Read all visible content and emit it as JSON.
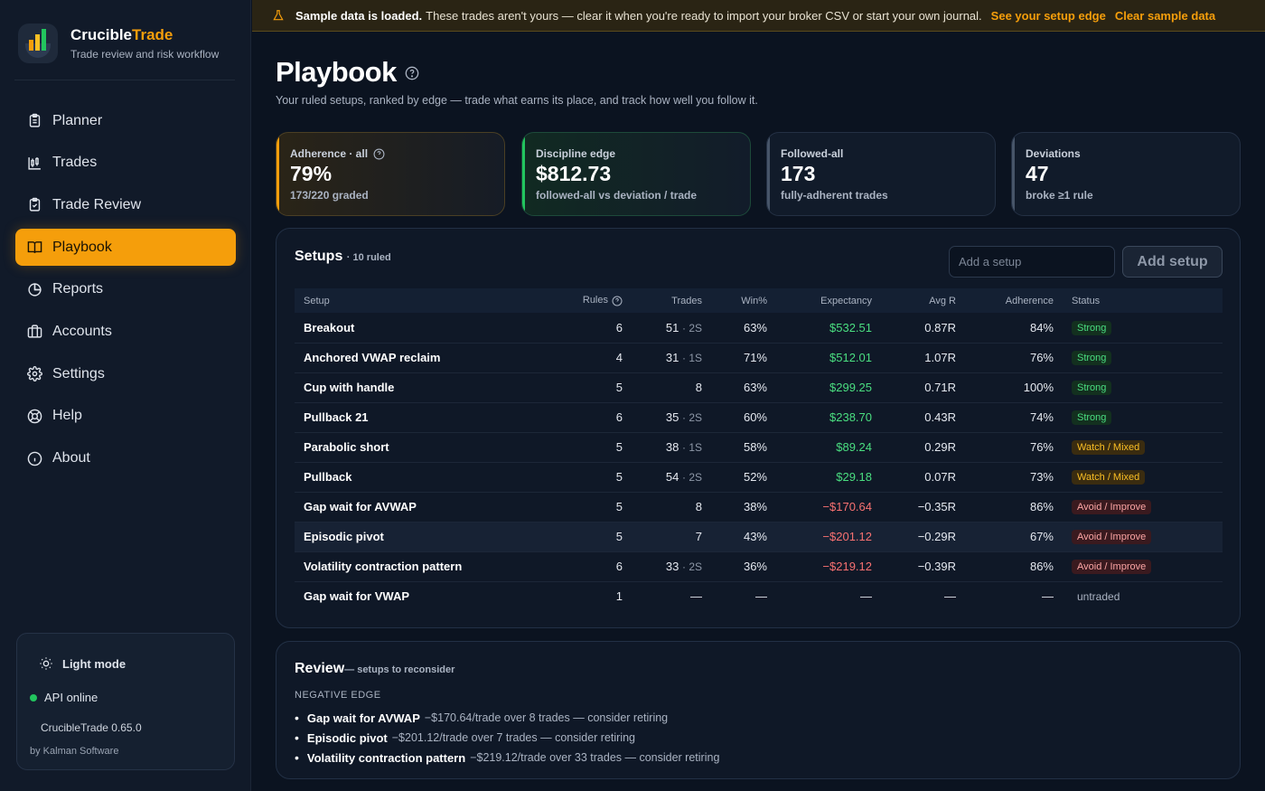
{
  "brand": {
    "name_main": "Crucible",
    "name_accent": "Trade",
    "tagline": "Trade review and risk workflow"
  },
  "nav": [
    {
      "label": "Planner",
      "icon": "clipboard-icon",
      "active": false
    },
    {
      "label": "Trades",
      "icon": "candlestick-icon",
      "active": false
    },
    {
      "label": "Trade Review",
      "icon": "clipboard-check-icon",
      "active": false
    },
    {
      "label": "Playbook",
      "icon": "book-open-icon",
      "active": true
    },
    {
      "label": "Reports",
      "icon": "pie-chart-icon",
      "active": false
    },
    {
      "label": "Accounts",
      "icon": "briefcase-icon",
      "active": false
    },
    {
      "label": "Settings",
      "icon": "gear-icon",
      "active": false
    },
    {
      "label": "Help",
      "icon": "lifebuoy-icon",
      "active": false
    },
    {
      "label": "About",
      "icon": "info-icon",
      "active": false
    }
  ],
  "sidebar_footer": {
    "light_mode": "Light mode",
    "api_status": "API online",
    "version": "CrucibleTrade 0.65.0",
    "byline": "by Kalman Software"
  },
  "banner": {
    "strong": "Sample data is loaded.",
    "text": "These trades aren't yours — clear it when you're ready to import your broker CSV or start your own journal.",
    "link1": "See your setup edge",
    "link2": "Clear sample data"
  },
  "page": {
    "title": "Playbook",
    "subtitle": "Your ruled setups, ranked by edge — trade what earns its place, and track how well you follow it."
  },
  "cards": [
    {
      "label": "Adherence · all",
      "value": "79%",
      "note": "173/220 graded",
      "edge_color": "#f59e0b"
    },
    {
      "label": "Discipline edge",
      "value": "$812.73",
      "note": "followed-all vs deviation / trade",
      "edge_color": "#22c55e"
    },
    {
      "label": "Followed-all",
      "value": "173",
      "note": "fully-adherent trades",
      "edge_color": "#475569"
    },
    {
      "label": "Deviations",
      "value": "47",
      "note": "broke ≥1 rule",
      "edge_color": "#475569"
    }
  ],
  "setups": {
    "title": "Setups",
    "count": "· 10 ruled",
    "input_placeholder": "Add a setup",
    "add_button": "Add setup",
    "columns": [
      "Setup",
      "Rules",
      "Trades",
      "Win%",
      "Expectancy",
      "Avg R",
      "Adherence",
      "Status"
    ],
    "rows": [
      {
        "setup": "Breakout",
        "rules": "6",
        "trades": "51",
        "sessions": "· 2S",
        "win": "63%",
        "expectancy": "$532.51",
        "exp_sign": "pos",
        "avg_r": "0.87R",
        "adherence": "84%",
        "status": "Strong",
        "status_kind": "strong"
      },
      {
        "setup": "Anchored VWAP reclaim",
        "rules": "4",
        "trades": "31",
        "sessions": "· 1S",
        "win": "71%",
        "expectancy": "$512.01",
        "exp_sign": "pos",
        "avg_r": "1.07R",
        "adherence": "76%",
        "status": "Strong",
        "status_kind": "strong"
      },
      {
        "setup": "Cup with handle",
        "rules": "5",
        "trades": "8",
        "sessions": "",
        "win": "63%",
        "expectancy": "$299.25",
        "exp_sign": "pos",
        "avg_r": "0.71R",
        "adherence": "100%",
        "status": "Strong",
        "status_kind": "strong"
      },
      {
        "setup": "Pullback 21",
        "rules": "6",
        "trades": "35",
        "sessions": "· 2S",
        "win": "60%",
        "expectancy": "$238.70",
        "exp_sign": "pos",
        "avg_r": "0.43R",
        "adherence": "74%",
        "status": "Strong",
        "status_kind": "strong"
      },
      {
        "setup": "Parabolic short",
        "rules": "5",
        "trades": "38",
        "sessions": "· 1S",
        "win": "58%",
        "expectancy": "$89.24",
        "exp_sign": "pos",
        "avg_r": "0.29R",
        "adherence": "76%",
        "status": "Watch / Mixed",
        "status_kind": "watch"
      },
      {
        "setup": "Pullback",
        "rules": "5",
        "trades": "54",
        "sessions": "· 2S",
        "win": "52%",
        "expectancy": "$29.18",
        "exp_sign": "pos",
        "avg_r": "0.07R",
        "adherence": "73%",
        "status": "Watch / Mixed",
        "status_kind": "watch"
      },
      {
        "setup": "Gap wait for AVWAP",
        "rules": "5",
        "trades": "8",
        "sessions": "",
        "win": "38%",
        "expectancy": "−$170.64",
        "exp_sign": "neg",
        "avg_r": "−0.35R",
        "adherence": "86%",
        "status": "Avoid / Improve",
        "status_kind": "avoid"
      },
      {
        "setup": "Episodic pivot",
        "rules": "5",
        "trades": "7",
        "sessions": "",
        "win": "43%",
        "expectancy": "−$201.12",
        "exp_sign": "neg",
        "avg_r": "−0.29R",
        "adherence": "67%",
        "status": "Avoid / Improve",
        "status_kind": "avoid",
        "highlight": true
      },
      {
        "setup": "Volatility contraction pattern",
        "rules": "6",
        "trades": "33",
        "sessions": "· 2S",
        "win": "36%",
        "expectancy": "−$219.12",
        "exp_sign": "neg",
        "avg_r": "−0.39R",
        "adherence": "86%",
        "status": "Avoid / Improve",
        "status_kind": "avoid"
      },
      {
        "setup": "Gap wait for VWAP",
        "rules": "1",
        "trades": "—",
        "sessions": "",
        "win": "—",
        "expectancy": "—",
        "exp_sign": "none",
        "avg_r": "—",
        "adherence": "—",
        "status": "untraded",
        "status_kind": "none"
      }
    ]
  },
  "review": {
    "title": "Review",
    "subtitle": "— setups to reconsider",
    "section": "NEGATIVE EDGE",
    "items": [
      {
        "name": "Gap wait for AVWAP",
        "detail": "−$170.64/trade over 8 trades — consider retiring"
      },
      {
        "name": "Episodic pivot",
        "detail": "−$201.12/trade over 7 trades — consider retiring"
      },
      {
        "name": "Volatility contraction pattern",
        "detail": "−$219.12/trade over 33 trades — consider retiring"
      }
    ]
  }
}
